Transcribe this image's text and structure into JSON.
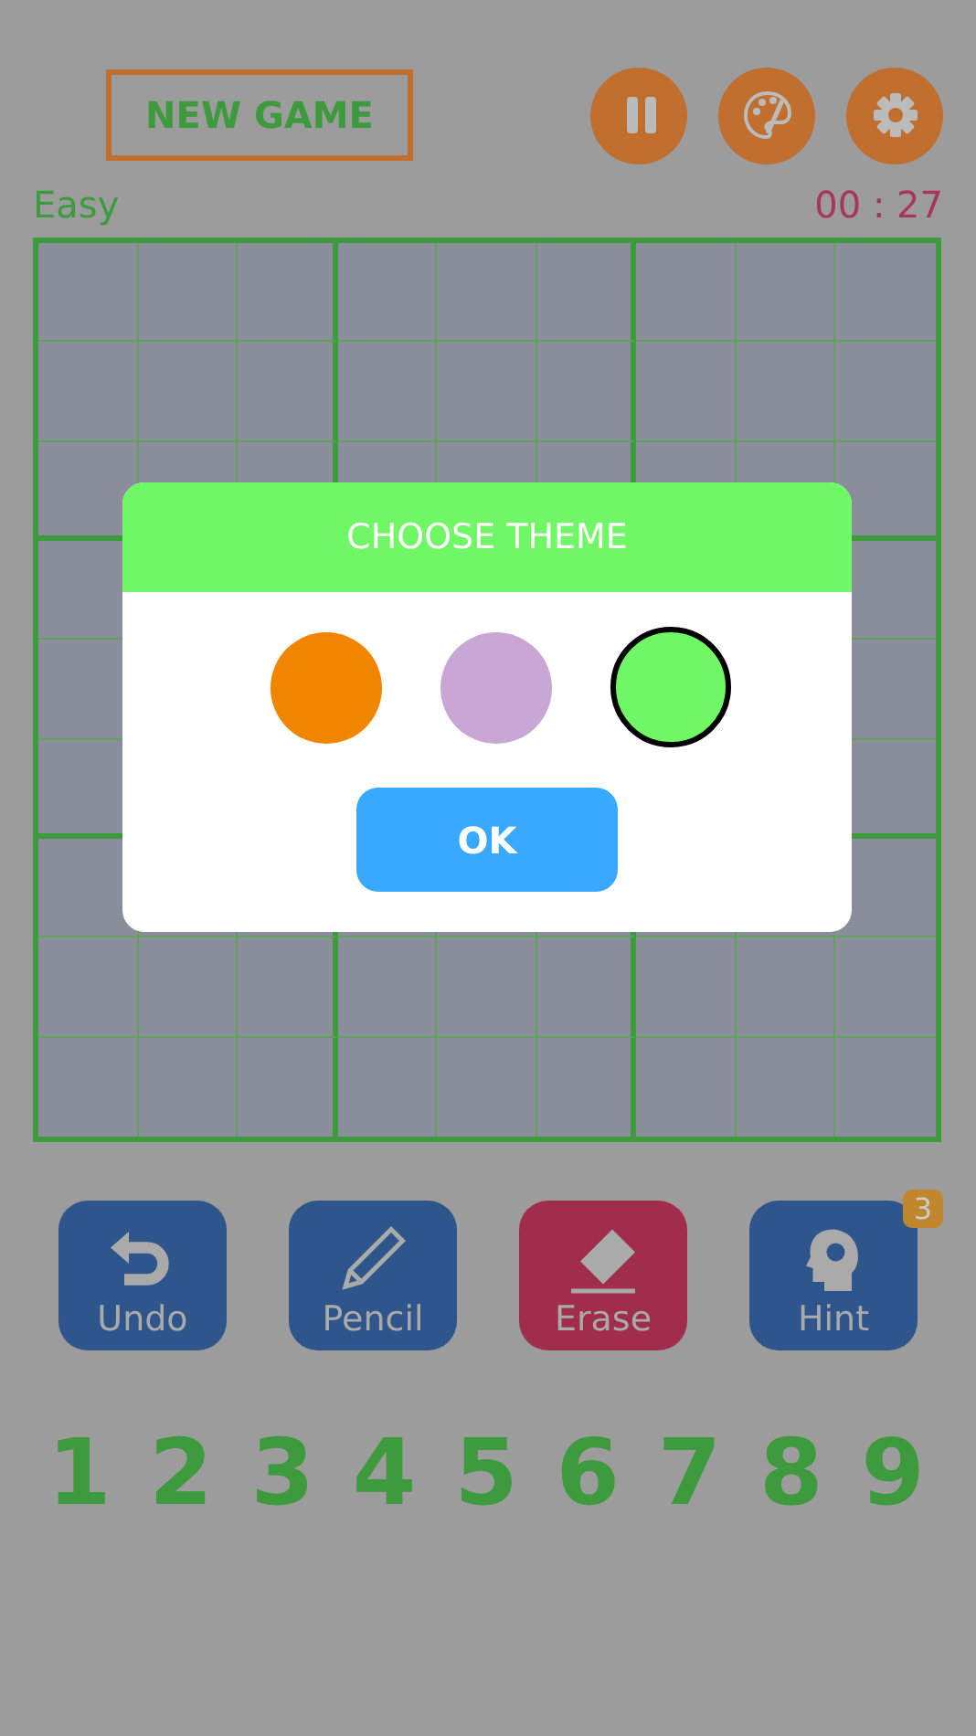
{
  "header": {
    "new_game": "NEW GAME",
    "actions": [
      {
        "kind": "pause"
      },
      {
        "kind": "palette"
      },
      {
        "kind": "settings"
      }
    ]
  },
  "status": {
    "difficulty": "Easy",
    "timer": "00 : 27"
  },
  "tools": [
    {
      "kind": "undo",
      "label": "Undo"
    },
    {
      "kind": "pencil",
      "label": "Pencil"
    },
    {
      "kind": "erase",
      "label": "Erase"
    },
    {
      "kind": "hint",
      "label": "Hint",
      "badge": "3"
    }
  ],
  "numbers": [
    "1",
    "2",
    "3",
    "4",
    "5",
    "6",
    "7",
    "8",
    "9"
  ],
  "dialog": {
    "title": "CHOOSE THEME",
    "themes": [
      {
        "color": "#f28500",
        "selected": false
      },
      {
        "color": "#c8a6d6",
        "selected": false
      },
      {
        "color": "#6ff766",
        "selected": true
      }
    ],
    "ok": "OK"
  }
}
